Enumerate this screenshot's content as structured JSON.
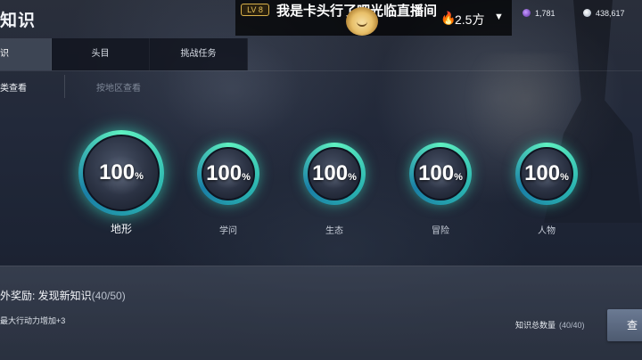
{
  "header": {
    "title": "知识"
  },
  "live": {
    "level": "LV 8",
    "title": "我是卡头行了吧光临直播间",
    "heat_value": "2.5方",
    "heat_icon": "flame-icon",
    "dropdown_icon": "chevron-down-icon"
  },
  "resources": [
    {
      "icon": "purple-gem-icon",
      "value": "1,781"
    },
    {
      "icon": "silver-coin-icon",
      "value": "438,617"
    }
  ],
  "tabs": [
    {
      "label": "识",
      "active": true
    },
    {
      "label": "头目",
      "active": false
    },
    {
      "label": "挑战任务",
      "active": false
    }
  ],
  "filters": {
    "by_category": "类查看",
    "by_region": "按地区查看"
  },
  "categories": [
    {
      "value": "100",
      "unit": "%",
      "label": "地形",
      "selected": true
    },
    {
      "value": "100",
      "unit": "%",
      "label": "学问",
      "selected": false
    },
    {
      "value": "100",
      "unit": "%",
      "label": "生态",
      "selected": false
    },
    {
      "value": "100",
      "unit": "%",
      "label": "冒险",
      "selected": false
    },
    {
      "value": "100",
      "unit": "%",
      "label": "人物",
      "selected": false
    }
  ],
  "reward": {
    "title": "外奖励: 发现新知识",
    "count": "(40/50)",
    "description": "最大行动力增加+3"
  },
  "total": {
    "label": "知识总数量",
    "count": "(40/40)"
  },
  "view_button": "查"
}
